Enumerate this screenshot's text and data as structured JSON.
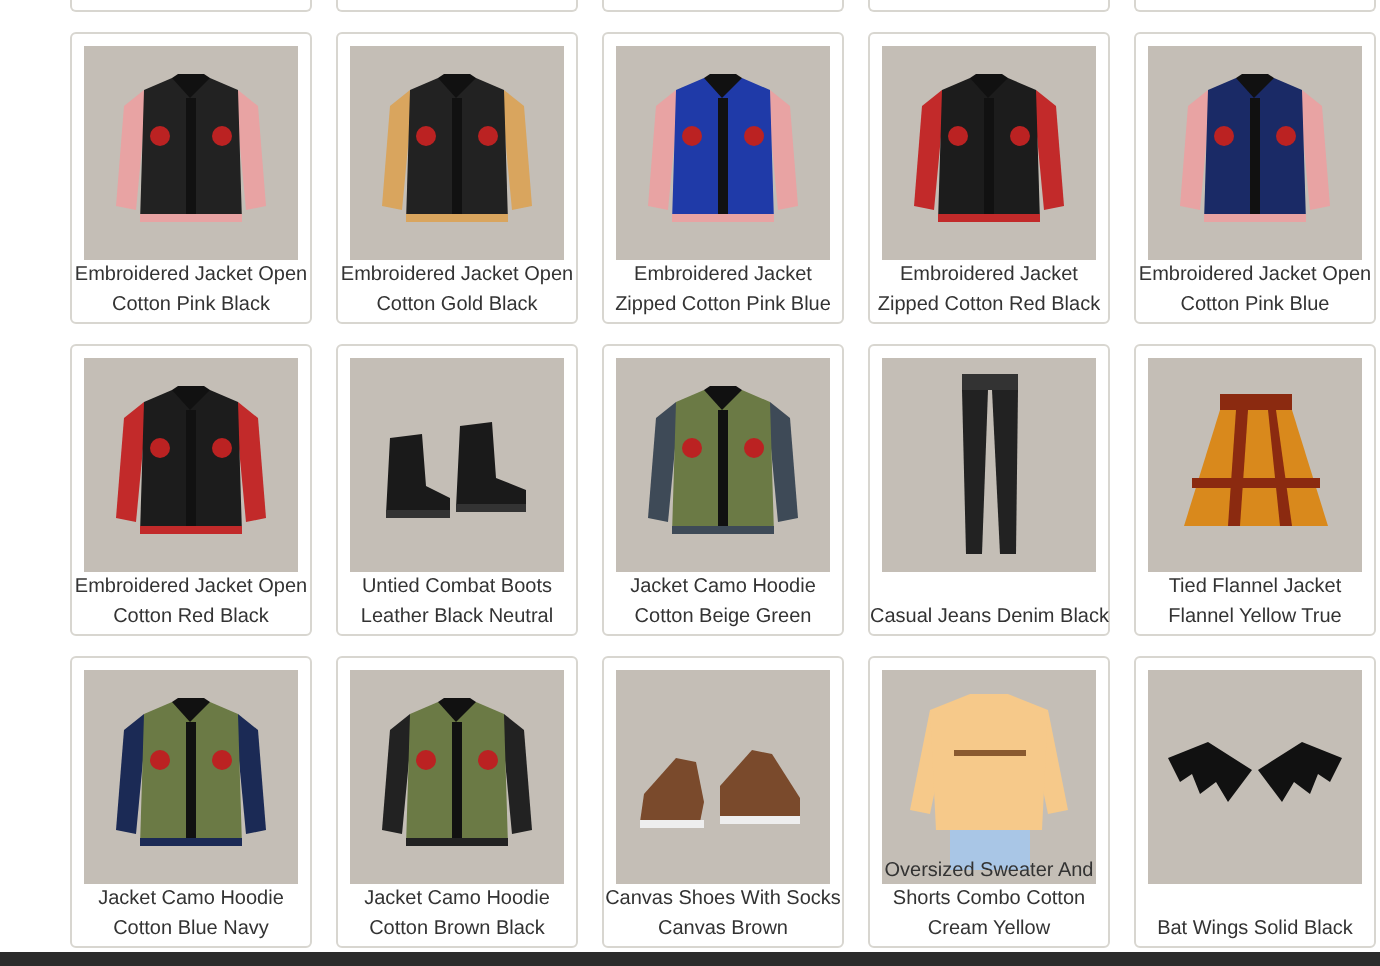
{
  "products": [
    {
      "caption": [
        "Embroidered Jacket Open",
        "Cotton Pink Black"
      ]
    },
    {
      "caption": [
        "Embroidered Jacket Open",
        "Cotton Gold Black"
      ]
    },
    {
      "caption": [
        "Embroidered Jacket",
        "Zipped Cotton Pink Blue"
      ]
    },
    {
      "caption": [
        "Embroidered Jacket",
        "Zipped Cotton Red Black"
      ]
    },
    {
      "caption": [
        "Embroidered Jacket Open",
        "Cotton Pink Blue"
      ]
    },
    {
      "caption": [
        "Embroidered Jacket Open",
        "Cotton Red Black"
      ]
    },
    {
      "caption": [
        "Untied Combat Boots",
        "Leather Black Neutral"
      ]
    },
    {
      "caption": [
        "Jacket Camo Hoodie",
        "Cotton Beige Green"
      ]
    },
    {
      "caption": [
        "Casual Jeans Denim Black"
      ]
    },
    {
      "caption": [
        "Tied Flannel Jacket",
        "Flannel Yellow True"
      ]
    },
    {
      "caption": [
        "Jacket Camo Hoodie",
        "Cotton Blue Navy"
      ]
    },
    {
      "caption": [
        "Jacket Camo Hoodie",
        "Cotton Brown Black"
      ]
    },
    {
      "caption": [
        "Canvas Shoes With Socks",
        "Canvas Brown"
      ]
    },
    {
      "caption": [
        "Oversized Sweater And",
        "Shorts Combo Cotton",
        "Cream Yellow"
      ]
    },
    {
      "caption": [
        "Bat Wings Solid Black"
      ]
    }
  ]
}
